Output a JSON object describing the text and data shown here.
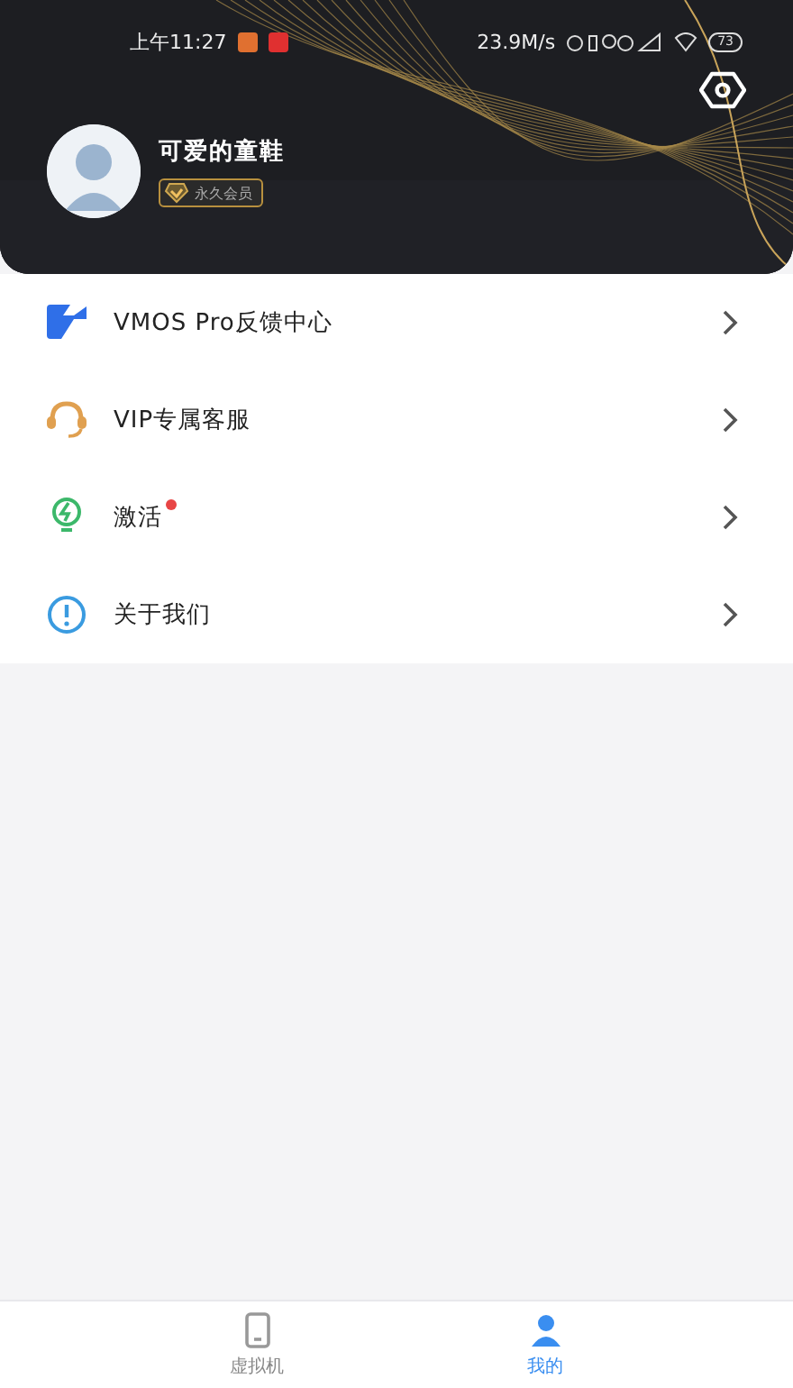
{
  "status_bar": {
    "time": "上午11:27",
    "speed": "23.9M/s",
    "battery": "73"
  },
  "profile": {
    "name": "可爱的童鞋",
    "badge": "永久会员"
  },
  "menu": [
    {
      "label": "VMOS Pro反馈中心",
      "dot": false
    },
    {
      "label": "VIP专属客服",
      "dot": false
    },
    {
      "label": "激活",
      "dot": true
    },
    {
      "label": "关于我们",
      "dot": false
    }
  ],
  "tabs": [
    {
      "label": "虚拟机",
      "selected": false
    },
    {
      "label": "我的",
      "selected": true
    }
  ]
}
